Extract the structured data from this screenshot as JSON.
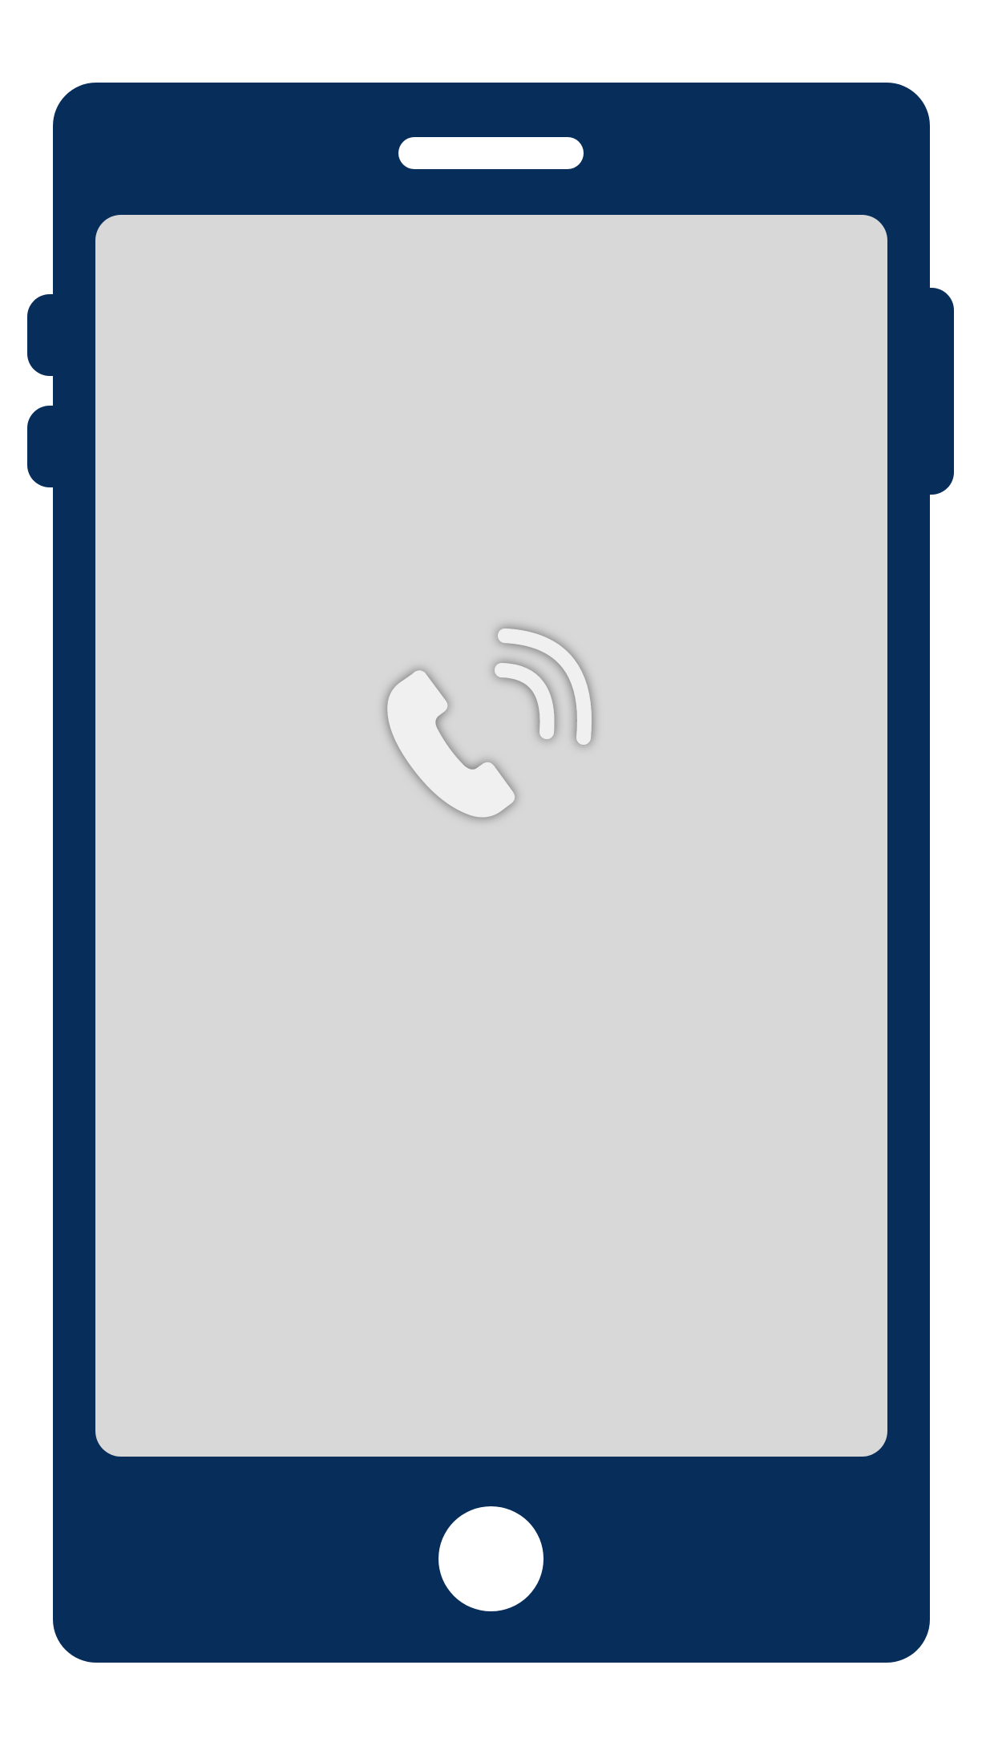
{
  "device": {
    "body_color": "#072d5a",
    "screen_color": "#d8d8d8",
    "accent_color": "#ffffff",
    "icon_color": "#f0f0f0"
  },
  "screen": {
    "icon": "phone-ringing-icon"
  }
}
